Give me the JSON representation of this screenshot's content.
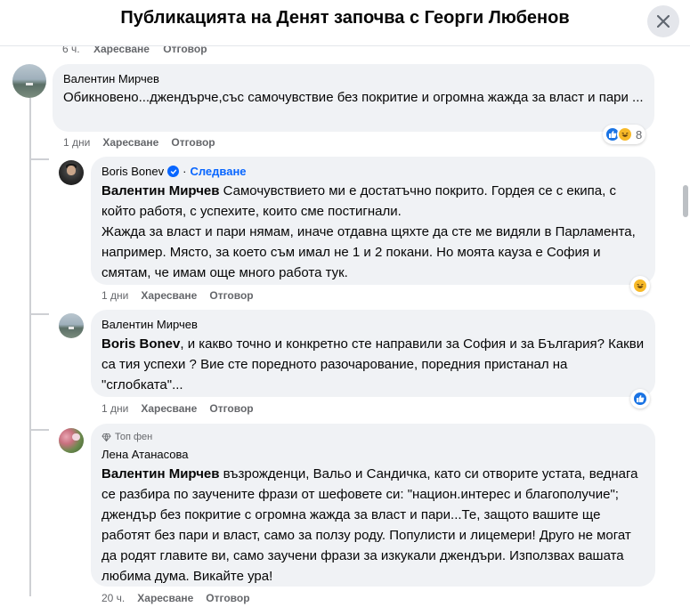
{
  "header": {
    "title": "Публикацията на Денят започва с Георги Любенов"
  },
  "previous_meta": {
    "time": "6 ч.",
    "like": "Харесване",
    "reply": "Отговор"
  },
  "comments": [
    {
      "author": "Валентин Мирчев",
      "text": "Обикновено...джендърче,със самочувствие без покритие и огромна жажда за власт и пари ...",
      "time": "1 дни",
      "like": "Харесване",
      "reply": "Отговор",
      "reaction_count": "8",
      "reactions": [
        "like-icon",
        "haha-icon"
      ]
    },
    {
      "author": "Boris Bonev",
      "follow": "Следване",
      "mention": "Валентин Мирчев",
      "text": " Самочувствието ми е достатъчно покрито. Гордея се с екипа, с който работя, с успехите, които сме постигнали.",
      "text2": "Жажда за власт и пари нямам, иначе отдавна щяхте да сте ме видяли в Парламента, например. Място, за което съм имал не 1 и 2 покани. Но моята кауза е София и смятам, че имам още много работа тук.",
      "time": "1 дни",
      "like": "Харесване",
      "reply": "Отговор",
      "reactions": [
        "haha-icon"
      ]
    },
    {
      "author": "Валентин Мирчев",
      "mention": "Boris Bonev",
      "text": ", и какво точно и конкретно сте направили за София и за България? Какви са тия успехи ? Вие сте поредното разочарование, поредния пристанал на \"сглобката\"...",
      "time": "1 дни",
      "like": "Харесване",
      "reply": "Отговор",
      "reactions": [
        "like-icon"
      ]
    },
    {
      "badge": "Топ фен",
      "author": "Лена Атанасова",
      "mention": "Валентин Мирчев",
      "text": " възрожденци, Вальо и Сандичка, като си отворите устата, веднага се разбира по заучените фрази от шефовете си: \"национ.интерес и благополучие\"; джендър без покритие с огромна жажда за власт и пари...Те, защото вашите ще работят без пари и власт, само за ползу роду. Популисти и лицемери! Друго не могат да родят главите ви, само заучени фрази за изкукали джендъри. Използвах вашата любима дума. Викайте ура!",
      "time": "20 ч.",
      "like": "Харесване",
      "reply": "Отговор"
    }
  ]
}
